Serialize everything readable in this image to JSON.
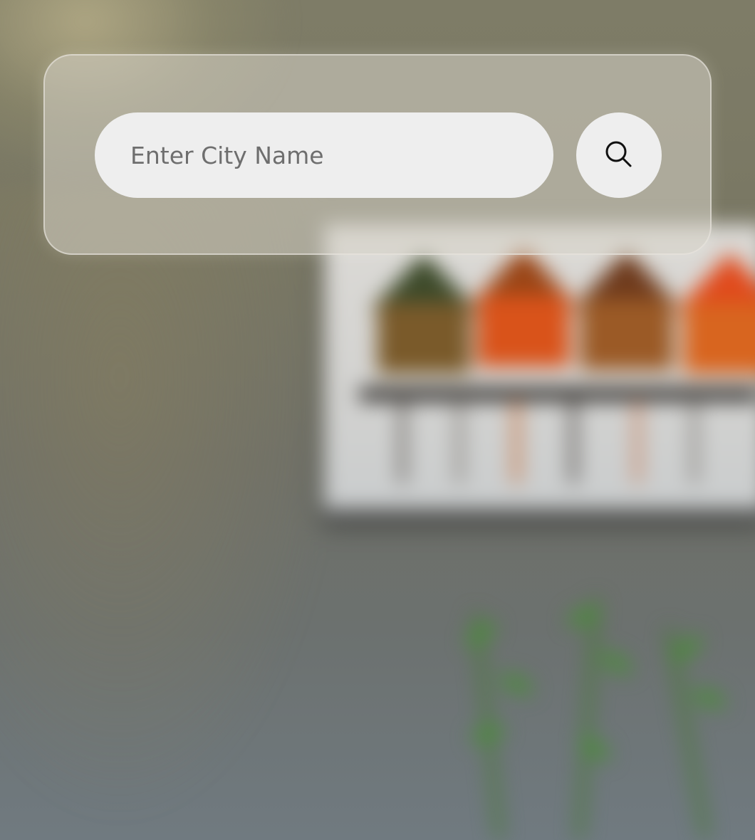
{
  "search": {
    "placeholder": "Enter City Name",
    "value": "",
    "button_icon": "search-icon"
  },
  "colors": {
    "panel_tint": "#d7d4c8",
    "input_background": "#eeeeee",
    "placeholder_text": "#6e6e6e",
    "icon_stroke": "#111111"
  }
}
